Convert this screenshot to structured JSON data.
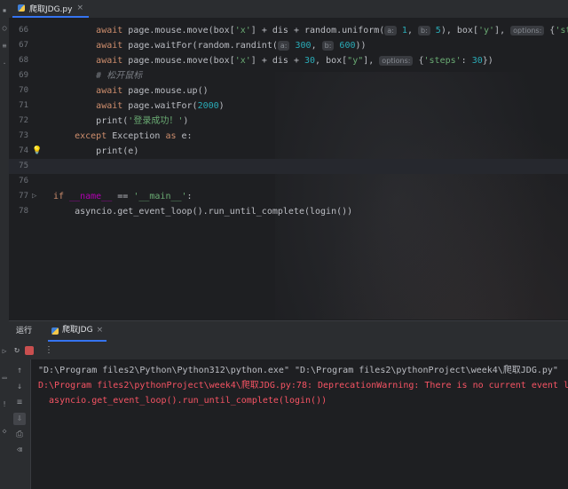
{
  "tab": {
    "file_name": "爬取JDG.py",
    "close": "×"
  },
  "editor": {
    "lines": [
      {
        "num": "66",
        "segments": [
          {
            "t": "        ",
            "c": ""
          },
          {
            "t": "await ",
            "c": "kw"
          },
          {
            "t": "page.mouse.move(box[",
            "c": ""
          },
          {
            "t": "'x'",
            "c": "str"
          },
          {
            "t": "] + dis + random.uniform(",
            "c": ""
          },
          {
            "t": "a:",
            "c": "hint"
          },
          {
            "t": " 1",
            "c": "num"
          },
          {
            "t": ", ",
            "c": ""
          },
          {
            "t": "b:",
            "c": "hint"
          },
          {
            "t": " 5",
            "c": "num"
          },
          {
            "t": "), box[",
            "c": ""
          },
          {
            "t": "'y'",
            "c": "str"
          },
          {
            "t": "], ",
            "c": ""
          },
          {
            "t": "options:",
            "c": "hint"
          },
          {
            "t": " {",
            "c": ""
          },
          {
            "t": "'steps'",
            "c": "str"
          }
        ]
      },
      {
        "num": "67",
        "segments": [
          {
            "t": "        ",
            "c": ""
          },
          {
            "t": "await ",
            "c": "kw"
          },
          {
            "t": "page.waitFor(random.randint(",
            "c": ""
          },
          {
            "t": "a:",
            "c": "hint"
          },
          {
            "t": " 300",
            "c": "num"
          },
          {
            "t": ", ",
            "c": ""
          },
          {
            "t": "b:",
            "c": "hint"
          },
          {
            "t": " 600",
            "c": "num"
          },
          {
            "t": "))",
            "c": ""
          }
        ]
      },
      {
        "num": "68",
        "segments": [
          {
            "t": "        ",
            "c": ""
          },
          {
            "t": "await ",
            "c": "kw"
          },
          {
            "t": "page.mouse.move(box[",
            "c": ""
          },
          {
            "t": "'x'",
            "c": "str"
          },
          {
            "t": "] + dis + ",
            "c": ""
          },
          {
            "t": "30",
            "c": "num"
          },
          {
            "t": ", box[",
            "c": ""
          },
          {
            "t": "\"y\"",
            "c": "str"
          },
          {
            "t": "], ",
            "c": ""
          },
          {
            "t": "options:",
            "c": "hint"
          },
          {
            "t": " {",
            "c": ""
          },
          {
            "t": "'steps'",
            "c": "str"
          },
          {
            "t": ": ",
            "c": ""
          },
          {
            "t": "30",
            "c": "num"
          },
          {
            "t": "})",
            "c": ""
          }
        ]
      },
      {
        "num": "69",
        "segments": [
          {
            "t": "        ",
            "c": ""
          },
          {
            "t": "# 松开鼠标",
            "c": "cmt"
          }
        ]
      },
      {
        "num": "70",
        "segments": [
          {
            "t": "        ",
            "c": ""
          },
          {
            "t": "await ",
            "c": "kw"
          },
          {
            "t": "page.mouse.up()",
            "c": ""
          }
        ]
      },
      {
        "num": "71",
        "segments": [
          {
            "t": "        ",
            "c": ""
          },
          {
            "t": "await ",
            "c": "kw"
          },
          {
            "t": "page.waitFor(",
            "c": ""
          },
          {
            "t": "2000",
            "c": "num"
          },
          {
            "t": ")",
            "c": ""
          }
        ]
      },
      {
        "num": "72",
        "segments": [
          {
            "t": "        ",
            "c": ""
          },
          {
            "t": "print(",
            "c": ""
          },
          {
            "t": "'登录成功！'",
            "c": "str"
          },
          {
            "t": ")",
            "c": ""
          }
        ]
      },
      {
        "num": "73",
        "segments": [
          {
            "t": "    ",
            "c": ""
          },
          {
            "t": "except ",
            "c": "kw"
          },
          {
            "t": "Exception ",
            "c": ""
          },
          {
            "t": "as ",
            "c": "kw"
          },
          {
            "t": "e:",
            "c": ""
          }
        ]
      },
      {
        "num": "74",
        "segments": [
          {
            "t": "        ",
            "c": ""
          },
          {
            "t": "print(e)",
            "c": ""
          }
        ]
      },
      {
        "num": "75",
        "segments": [],
        "current": true
      },
      {
        "num": "76",
        "segments": []
      },
      {
        "num": "77",
        "segments": [
          {
            "t": "if ",
            "c": "kw"
          },
          {
            "t": "__name__",
            "c": "dunder"
          },
          {
            "t": " == ",
            "c": ""
          },
          {
            "t": "'__main__'",
            "c": "str"
          },
          {
            "t": ":",
            "c": ""
          }
        ]
      },
      {
        "num": "78",
        "segments": [
          {
            "t": "    ",
            "c": ""
          },
          {
            "t": "asyncio.get_event_loop().run_until_complete(login())",
            "c": ""
          }
        ]
      }
    ]
  },
  "run_panel": {
    "title": "运行",
    "config_name": "爬取JDG",
    "config_close": "×"
  },
  "console": {
    "lines": [
      {
        "text": "\"D:\\Program files2\\Python\\Python312\\python.exe\" \"D:\\Program files2\\pythonProject\\week4\\爬取JDG.py\"",
        "color": "#bcbec4"
      },
      {
        "text": "D:\\Program files2\\pythonProject\\week4\\爬取JDG.py:78: DeprecationWarning: There is no current event loop",
        "color": "#f75464"
      },
      {
        "text": "  asyncio.get_event_loop().run_until_complete(login())",
        "color": "#f75464"
      }
    ]
  },
  "colors": {
    "accent": "#3574f0",
    "error": "#f75464",
    "keyword": "#cf8e6d",
    "string": "#6aab73",
    "number": "#2aacb8"
  }
}
